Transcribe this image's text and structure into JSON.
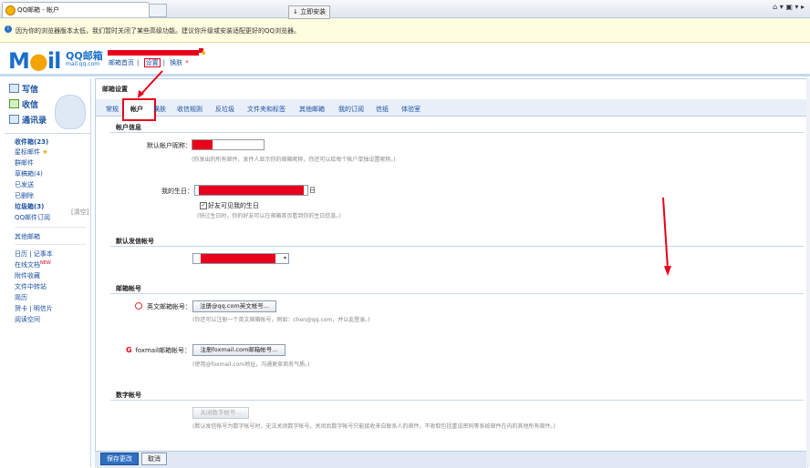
{
  "browser": {
    "tab_title": "QQ邮箱 - 帐户",
    "tools": "⌂ ▾ ▣ ▾ ▸"
  },
  "warning": {
    "icon": "info-icon",
    "message": "因为你的浏览器版本太低，我们暂时关闭了某些高级功能。建议你升级或安装适配更好的QQ浏览器。",
    "install_label": "↓ 立即安装"
  },
  "header": {
    "logo": "M",
    "logo_o": "●",
    "logo_rest": "il",
    "brand": "QQ邮箱",
    "domain": "mail.qq.com",
    "links": [
      "邮箱首页",
      "设置",
      "换肤"
    ],
    "link_sep": "|",
    "skin_star": "*"
  },
  "sidebar": {
    "compose": "写信",
    "receive": "收信",
    "contacts": "通讯录",
    "folders": [
      {
        "label": "收件箱(23)",
        "bold": true
      },
      {
        "label": "星标邮件",
        "star": "★"
      },
      {
        "label": "群邮件"
      },
      {
        "label": "草稿箱(4)"
      },
      {
        "label": "已发送"
      },
      {
        "label": "已删除"
      },
      {
        "label": "垃圾箱(3)",
        "bold": true
      },
      {
        "label": "QQ邮件订阅"
      }
    ],
    "clear": "[清空]",
    "other": "其他邮箱",
    "tools": [
      "日历 | 记事本",
      "在线文档",
      "附件收藏",
      "文件中转站",
      "简历",
      "贺卡 | 明信片",
      "阅读空间"
    ],
    "new_badge": "NEW"
  },
  "main": {
    "title": "邮箱设置",
    "tabs": [
      "常规",
      "帐户",
      "换肤",
      "收信规则",
      "反垃圾",
      "文件夹和标签",
      "其他邮箱",
      "我的订阅",
      "信纸",
      "体验室"
    ],
    "account_info": {
      "heading": "帐户信息",
      "nickname_label": "默认帐户昵称：",
      "nickname_hint": "(你发出的所有邮件，发件人显示你的邮箱昵称，你还可以给每个帐户单独设置昵称。)",
      "birthday_label": "我的生日：",
      "birthday_suffix": "日",
      "birthday_check": "✓",
      "birthday_check_label": "好友可见我的生日",
      "birthday_hint": "(快过生日时，你的好友可以在邮箱首页看到你的生日信息。)"
    },
    "default_sender": {
      "heading": "默认发信帐号"
    },
    "mail_accounts": {
      "heading": "邮箱帐号",
      "english_label": "英文邮箱帐号：",
      "english_button": "注册@qq.com英文帐号...",
      "english_hint": "(你还可以注册一个英文邮箱帐号，例如：chen@qq.com，并以此登录。)",
      "foxmail_label": "foxmail邮箱帐号：",
      "foxmail_button": "注册foxmail.com邮箱帐号...",
      "foxmail_hint": "(使用@foxmail.com地址，沟通更显商务气质。)"
    },
    "numeric_account": {
      "heading": "数字帐号",
      "button": "关闭数字帐号...",
      "hint": "(默认发信帐号为数字帐号时，无法关闭数字帐号。关闭后数字帐号只能接收来自联系人的邮件，不收取包括重设密码等系统邮件在内的其他所有邮件。)"
    }
  },
  "footer": {
    "save": "保存更改",
    "cancel": "取消"
  },
  "colors": {
    "accent": "#1a6fc9",
    "annotation": "#e8001c",
    "warning_bg": "#fffde0"
  }
}
